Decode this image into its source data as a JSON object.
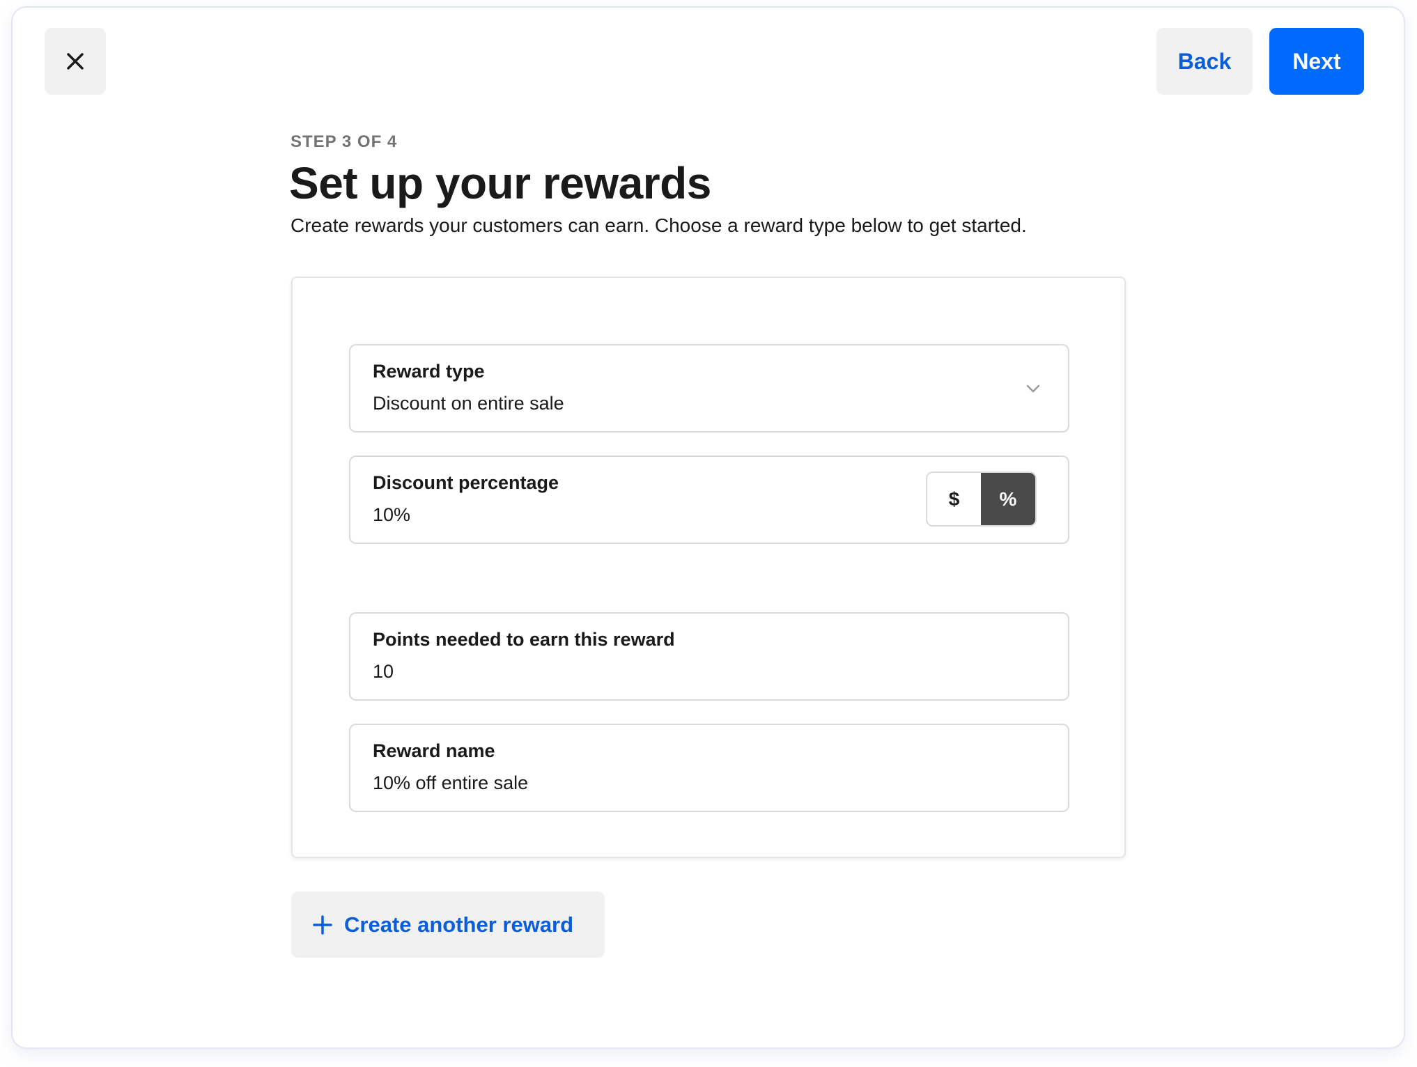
{
  "header": {
    "close_icon": "close-icon",
    "back_label": "Back",
    "next_label": "Next"
  },
  "intro": {
    "step": "STEP 3 OF 4",
    "title": "Set up your rewards",
    "subtitle": "Create rewards your customers can earn. Choose a reward type below to get started."
  },
  "reward": {
    "type": {
      "label": "Reward type",
      "value": "Discount on entire sale",
      "icon": "chevron-down-icon"
    },
    "discount": {
      "label": "Discount percentage",
      "value": "10%",
      "toggle": {
        "options": [
          "$",
          "%"
        ],
        "selected": "%"
      }
    },
    "points": {
      "label": "Points needed to earn this reward",
      "value": "10"
    },
    "name": {
      "label": "Reward name",
      "value": "10% off entire sale"
    }
  },
  "actions": {
    "create_another_label": "Create another reward",
    "create_icon": "plus-icon"
  },
  "colors": {
    "primary": "#006aff",
    "link": "#0a5ddb",
    "secondary_bg": "#f1f1f1",
    "toggle_selected": "#4a4a4a"
  }
}
